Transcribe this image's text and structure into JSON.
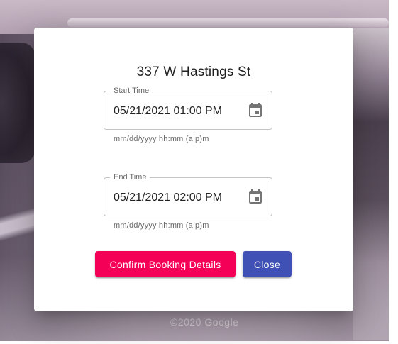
{
  "background": {
    "watermark": "©2020 Google"
  },
  "dialog": {
    "title": "337 W Hastings St",
    "start_field": {
      "label": "Start Time",
      "value": "05/21/2021 01:00 PM",
      "helper": "mm/dd/yyyy hh:mm (a|p)m",
      "icon": "calendar-icon"
    },
    "end_field": {
      "label": "End Time",
      "value": "05/21/2021 02:00 PM",
      "helper": "mm/dd/yyyy hh:mm (a|p)m",
      "icon": "calendar-icon"
    },
    "buttons": {
      "confirm_label": "Confirm Booking Details",
      "close_label": "Close"
    }
  },
  "colors": {
    "confirm": "#f50057",
    "close": "#3f51b5"
  }
}
